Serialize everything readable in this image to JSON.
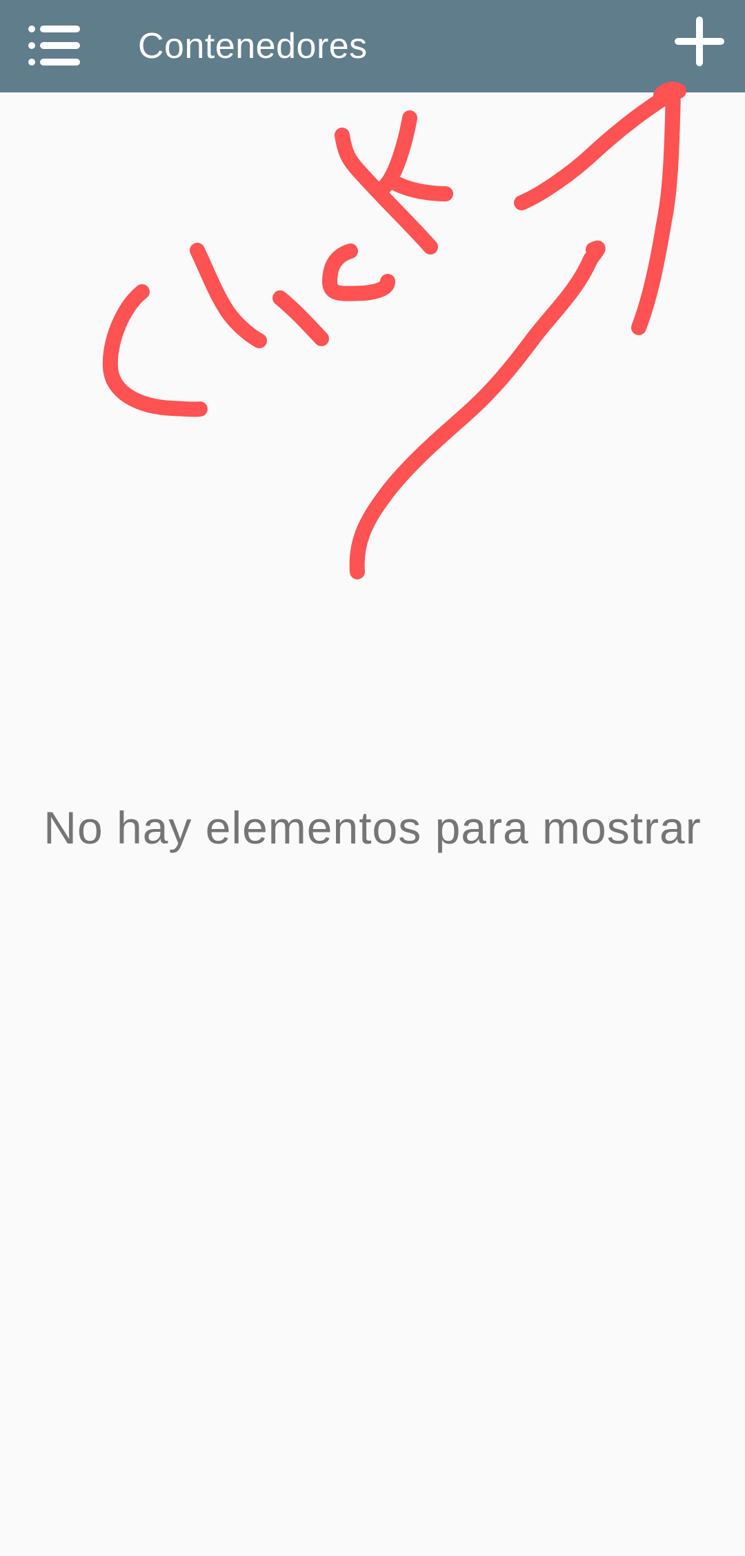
{
  "appbar": {
    "title": "Contenedores",
    "menu_icon": "list-icon",
    "add_icon": "plus-icon",
    "background": "#607d8b"
  },
  "main": {
    "empty_message": "No hay elementos para mostrar"
  },
  "annotation": {
    "color": "#ff5252",
    "icons": [
      "hand-drawn-click-text",
      "hand-drawn-arrow-icon"
    ]
  }
}
